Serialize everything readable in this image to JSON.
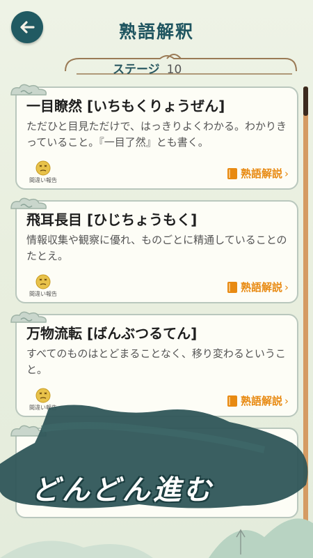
{
  "header": {
    "title": "熟語解釈",
    "back_icon": "arrow-left-icon"
  },
  "stage": {
    "label": "ステージ",
    "number": "10"
  },
  "cards": [
    {
      "title": "一目瞭然 [いちもくりょうぜん]",
      "description": "ただひと目見ただけで、はっきりよくわかる。わかりきっていること。『一目了然』とも書く。",
      "report_label": "間違い報告",
      "explain_label": "熟語解説"
    },
    {
      "title": "飛耳長目 [ひじちょうもく]",
      "description": "情報収集や観察に優れ、ものごとに精通していることのたとえ。",
      "report_label": "間違い報告",
      "explain_label": "熟語解説"
    },
    {
      "title": "万物流転 [ばんぶつるてん]",
      "description": "すべてのものはとどまることなく、移り変わるということ。",
      "report_label": "間違い報告",
      "explain_label": "熟語解説"
    }
  ],
  "banner": {
    "text": "どんどん進む"
  },
  "colors": {
    "accent": "#215a62",
    "orange": "#e88a12",
    "card_border": "#b9c7bd"
  }
}
